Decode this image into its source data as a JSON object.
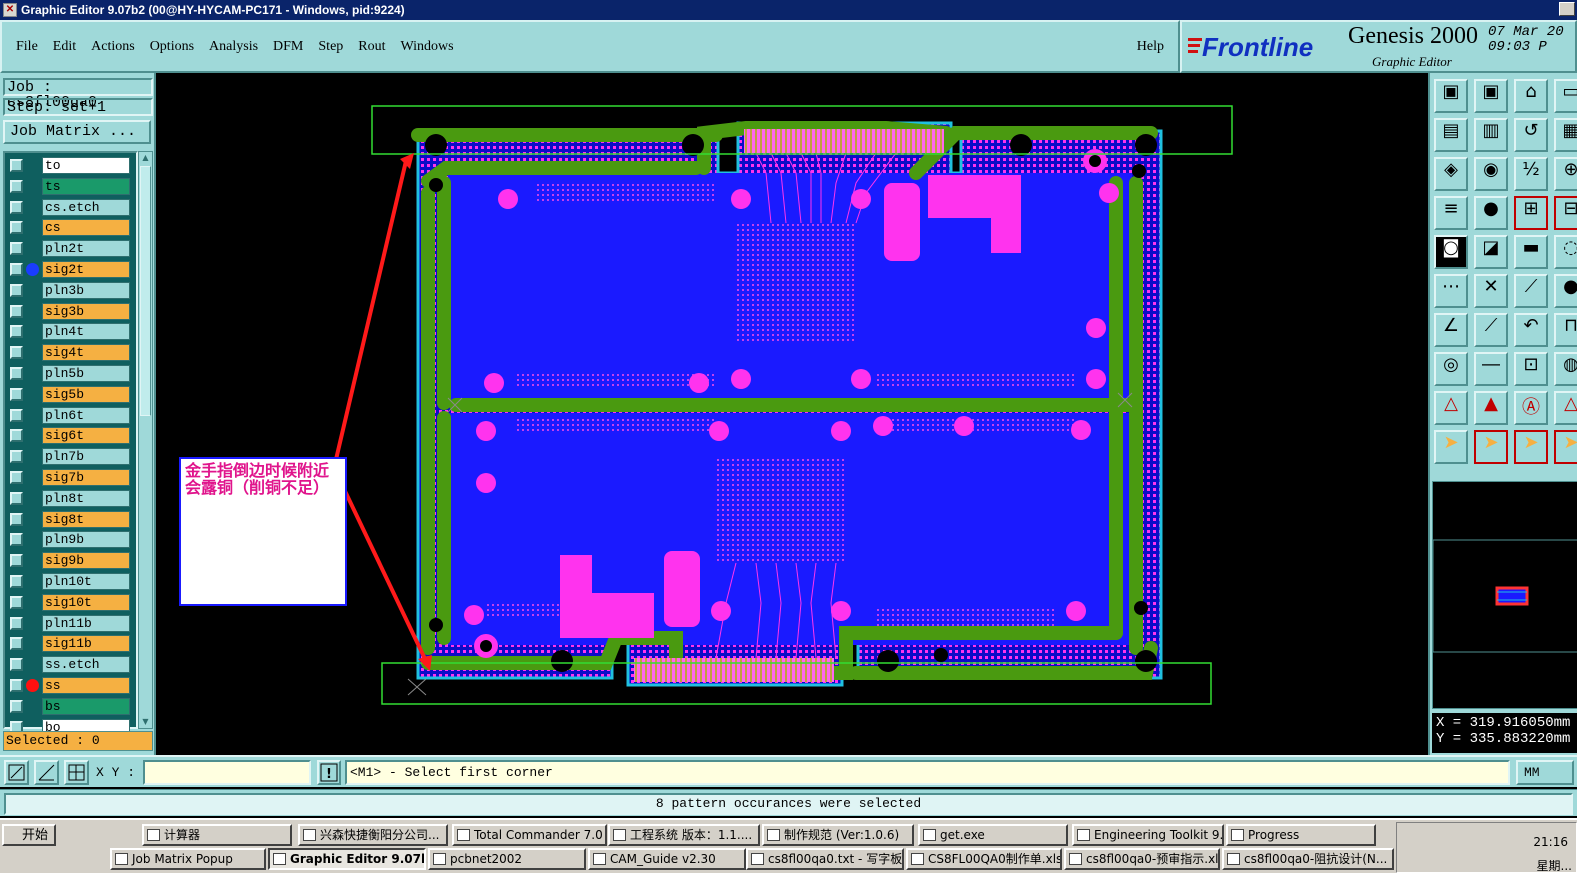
{
  "window": {
    "title": "Graphic Editor 9.07b2 (00@HY-HYCAM-PC171 - Windows, pid:9224)"
  },
  "menu": {
    "items": [
      "File",
      "Edit",
      "Actions",
      "Options",
      "Analysis",
      "DFM",
      "Step",
      "Rout",
      "Windows"
    ],
    "help": "Help"
  },
  "brand": {
    "logo": "Frontline",
    "product": "Genesis 2000",
    "subtitle": "Graphic Editor",
    "date": "07 Mar 20",
    "time": "09:03 P"
  },
  "job": {
    "job_label": "Job : cs8fl00qa0",
    "step_label": "Step: set+1",
    "matrix_button": "Job Matrix ..."
  },
  "layers": [
    {
      "name": "to",
      "color": "#ffffff",
      "dot": ""
    },
    {
      "name": "ts",
      "color": "#1a9a6a",
      "dot": ""
    },
    {
      "name": "cs.etch",
      "color": "#9fd9d9",
      "dot": ""
    },
    {
      "name": "cs",
      "color": "#f5b042",
      "dot": ""
    },
    {
      "name": "pln2t",
      "color": "#9fd9d9",
      "dot": ""
    },
    {
      "name": "sig2t",
      "color": "#f5b042",
      "dot": "#1a3cff"
    },
    {
      "name": "pln3b",
      "color": "#9fd9d9",
      "dot": ""
    },
    {
      "name": "sig3b",
      "color": "#f5b042",
      "dot": ""
    },
    {
      "name": "pln4t",
      "color": "#9fd9d9",
      "dot": ""
    },
    {
      "name": "sig4t",
      "color": "#f5b042",
      "dot": ""
    },
    {
      "name": "pln5b",
      "color": "#9fd9d9",
      "dot": ""
    },
    {
      "name": "sig5b",
      "color": "#f5b042",
      "dot": ""
    },
    {
      "name": "pln6t",
      "color": "#9fd9d9",
      "dot": ""
    },
    {
      "name": "sig6t",
      "color": "#f5b042",
      "dot": ""
    },
    {
      "name": "pln7b",
      "color": "#9fd9d9",
      "dot": ""
    },
    {
      "name": "sig7b",
      "color": "#f5b042",
      "dot": ""
    },
    {
      "name": "pln8t",
      "color": "#9fd9d9",
      "dot": ""
    },
    {
      "name": "sig8t",
      "color": "#f5b042",
      "dot": ""
    },
    {
      "name": "pln9b",
      "color": "#9fd9d9",
      "dot": ""
    },
    {
      "name": "sig9b",
      "color": "#f5b042",
      "dot": ""
    },
    {
      "name": "pln10t",
      "color": "#9fd9d9",
      "dot": ""
    },
    {
      "name": "sig10t",
      "color": "#f5b042",
      "dot": ""
    },
    {
      "name": "pln11b",
      "color": "#9fd9d9",
      "dot": ""
    },
    {
      "name": "sig11b",
      "color": "#f5b042",
      "dot": ""
    },
    {
      "name": "ss.etch",
      "color": "#9fd9d9",
      "dot": ""
    },
    {
      "name": "ss",
      "color": "#f5b042",
      "dot": "#ff1010"
    },
    {
      "name": "bs",
      "color": "#1a9a6a",
      "dot": ""
    },
    {
      "name": "bo",
      "color": "#ffffff",
      "dot": ""
    }
  ],
  "selected_count": "Selected : 0",
  "annotation": {
    "text": "金手指倒边时候附近会露铜（削铜不足）",
    "color": "#e0148c"
  },
  "coords": {
    "x": "X = 319.916050mm",
    "y": "Y = 335.883220mm"
  },
  "command": {
    "xy_label": "X Y :",
    "xy_value": "",
    "prompt": "<M1> - Select first corner",
    "units": "MM"
  },
  "status_message": "8 pattern occurances were selected",
  "taskbar": {
    "start": "开始",
    "row1": [
      "计算器",
      "兴森快捷衡阳分公司...",
      "Total Commander 7.0 p...",
      "工程系统  版本：1.1....",
      "制作规范 (Ver:1.0.6)",
      "get.exe",
      "Engineering Toolkit 9.0...",
      "Progress"
    ],
    "row2": [
      "Job Matrix Popup",
      "Graphic Editor 9.07b2...",
      "pcbnet2002",
      "CAM_Guide v2.30",
      "cs8fl00qa0.txt - 写字板",
      "CS8FL00QA0制作单.xls...",
      "cs8fl00qa0-预审指示.xl...",
      "cs8fl00qa0-阻抗设计(N..."
    ],
    "active": "Graphic Editor 9.07b2...",
    "clock": "21:16",
    "weekday": "星期..."
  },
  "colors": {
    "panel": "#9fd9d9",
    "board_fill": "#1a1aff",
    "pads": "#ff33ee",
    "rail": "#4a9a10",
    "selection_box": "#33dd33",
    "arrow": "#ff1a1a"
  }
}
